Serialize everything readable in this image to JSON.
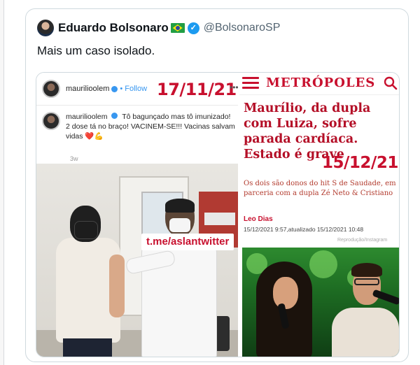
{
  "tweet": {
    "display_name": "Eduardo Bolsonaro",
    "handle": "@BolsonaroSP",
    "text": "Mais um caso isolado.",
    "flag_icon": "brazil-flag-icon",
    "verified_icon": "verified-badge-icon"
  },
  "instagram_panel": {
    "username": "maurilioolem",
    "follow_label": "• Follow",
    "more_label": "•••",
    "caption_user": "maurilioolem",
    "caption_text": "Tô bagunçado mas tô imunizado! 2 dose tá no braço! VACINEM-SE!!! Vacinas salvam vidas ❤️💪",
    "age": "3w",
    "date_overlay": "17/11/21",
    "watermark": "t.me/aslantwitter"
  },
  "metropoles_panel": {
    "logo": "METRÓPOLES",
    "headline": "Maurílio, da dupla com Luiza, sofre parada cardíaca. Estado é grave",
    "date_overlay": "15/12/21",
    "subtitle": "Os dois são donos do hit S de Saudade, em parceria com a dupla Zé Neto & Cristiano",
    "author": "Leo Dias",
    "timestamp": "15/12/2021 9:57,atualizado 15/12/2021 10:48",
    "photo_credit": "Reprodução/Instagram"
  },
  "colors": {
    "accent_red": "#c8102e",
    "twitter_blue": "#1d9bf0"
  }
}
